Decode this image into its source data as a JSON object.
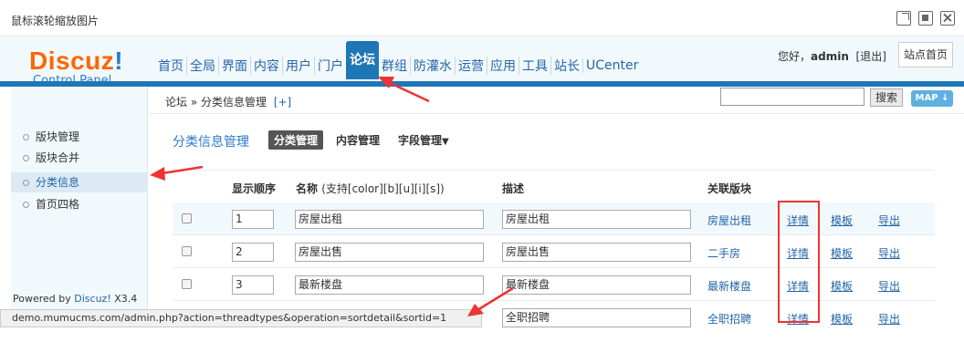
{
  "window": {
    "title": "鼠标滚轮缩放图片"
  },
  "logo": {
    "brand_main": "Discuz",
    "brand_ex": "!",
    "subtitle": "Control Panel"
  },
  "nav": {
    "items": [
      "首页",
      "全局",
      "界面",
      "内容",
      "用户",
      "门户",
      "论坛",
      "群组",
      "防灌水",
      "运营",
      "应用",
      "工具",
      "站长",
      "UCenter"
    ],
    "active": "论坛"
  },
  "header": {
    "greeting": "您好，",
    "username": "admin",
    "logout": "[退出]",
    "site_home": "站点首页"
  },
  "breadcrumb": {
    "text": "论坛 » 分类信息管理",
    "plus": "[+]"
  },
  "search": {
    "button": "搜索",
    "map": "MAP"
  },
  "sidebar": {
    "items": [
      {
        "label": "版块管理",
        "active": false
      },
      {
        "label": "版块合并",
        "active": false
      },
      {
        "label": "分类信息",
        "active": true
      },
      {
        "label": "首页四格",
        "active": false
      }
    ],
    "powered": "Powered by ",
    "powered_brand": "Discuz!",
    "powered_version": " X3.4"
  },
  "content": {
    "title": "分类信息管理",
    "tabs": [
      "分类管理",
      "内容管理",
      "字段管理"
    ],
    "active_tab": "分类管理"
  },
  "table": {
    "headers": {
      "order": "显示顺序",
      "name": "名称",
      "name_hint": "(支持[color][b][u][i][s])",
      "desc": "描述",
      "forum": "关联版块"
    },
    "rows": [
      {
        "order": "1",
        "name": "房屋出租",
        "desc": "房屋出租",
        "forum": "房屋出租",
        "detail": "详情",
        "template": "模板",
        "export": "导出"
      },
      {
        "order": "2",
        "name": "房屋出售",
        "desc": "房屋出售",
        "forum": "二手房",
        "detail": "详情",
        "template": "模板",
        "export": "导出"
      },
      {
        "order": "3",
        "name": "最新楼盘",
        "desc": "最新楼盘",
        "forum": "最新楼盘",
        "detail": "详情",
        "template": "模板",
        "export": "导出"
      },
      {
        "order": "",
        "name": "",
        "desc": "全职招聘",
        "forum": "全职招聘",
        "detail": "详情",
        "template": "模板",
        "export": "导出"
      }
    ]
  },
  "statusbar": {
    "url": "demo.mumucms.com/admin.php?action=threadtypes&operation=sortdetail&sortid=1"
  },
  "colors": {
    "accent": "#1f76b5",
    "link": "#2366a8",
    "logo": "#ff6600",
    "annotation": "#ee3333"
  }
}
